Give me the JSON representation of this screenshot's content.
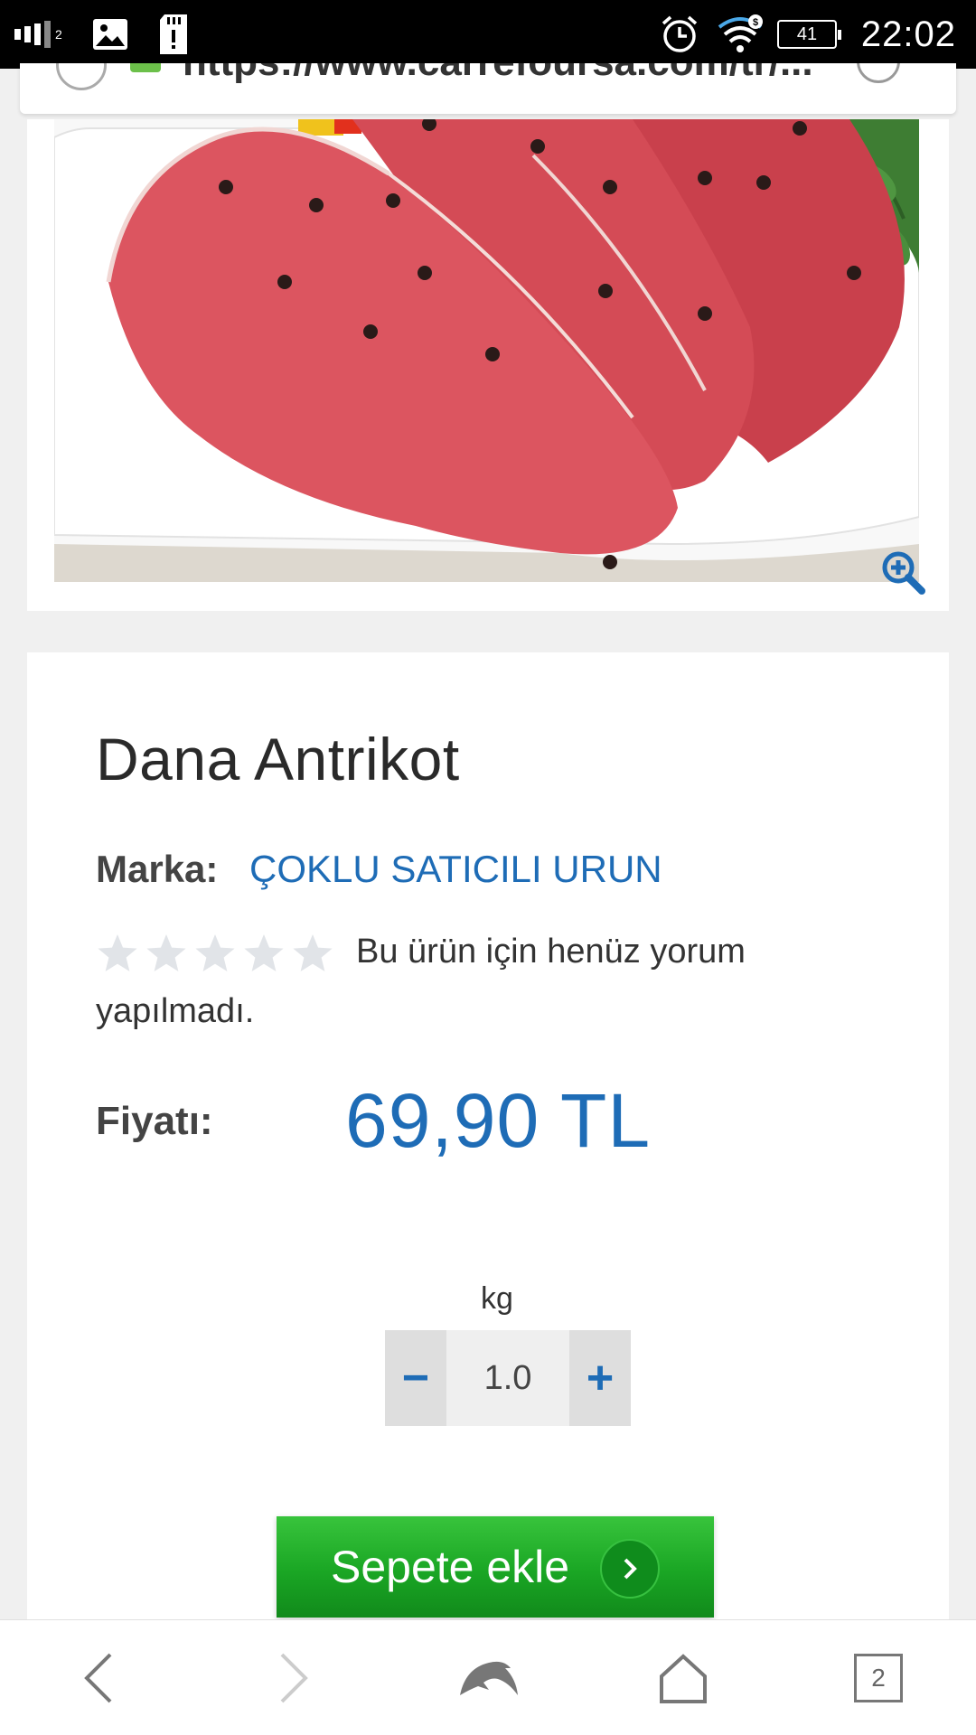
{
  "status_bar": {
    "signal_sub": "2",
    "battery": "41",
    "time": "22:02"
  },
  "url_bar": {
    "url": "https://www.carrefoursa.com/tr/..."
  },
  "product": {
    "title": "Dana Antrikot",
    "brand_label": "Marka:",
    "brand_value": "ÇOKLU SATICILI URUN",
    "rating_stars": 0,
    "rating_max": 5,
    "review_text": "Bu ürün için henüz yorum yapılmadı.",
    "price_label": "Fiyatı:",
    "price": "69,90 TL"
  },
  "quantity": {
    "unit": "kg",
    "minus": "−",
    "value": "1.0",
    "plus": "+"
  },
  "cart": {
    "label": "Sepete ekle"
  },
  "bottom_nav": {
    "tab_count": "2"
  },
  "colors": {
    "accent_blue": "#1e6cb6",
    "cart_green": "#1aa624",
    "meat": "#d94a55",
    "star_empty": "#e1e4e8"
  },
  "icons": [
    "signal-icon",
    "gallery-icon",
    "sd-card-icon",
    "alarm-icon",
    "wifi-icon",
    "battery-icon",
    "globe-icon",
    "lock-icon",
    "reload-icon",
    "zoom-icon",
    "star-icon",
    "chevron-right-icon",
    "back-icon",
    "forward-icon",
    "dolphin-icon",
    "home-icon",
    "tabs-icon"
  ]
}
